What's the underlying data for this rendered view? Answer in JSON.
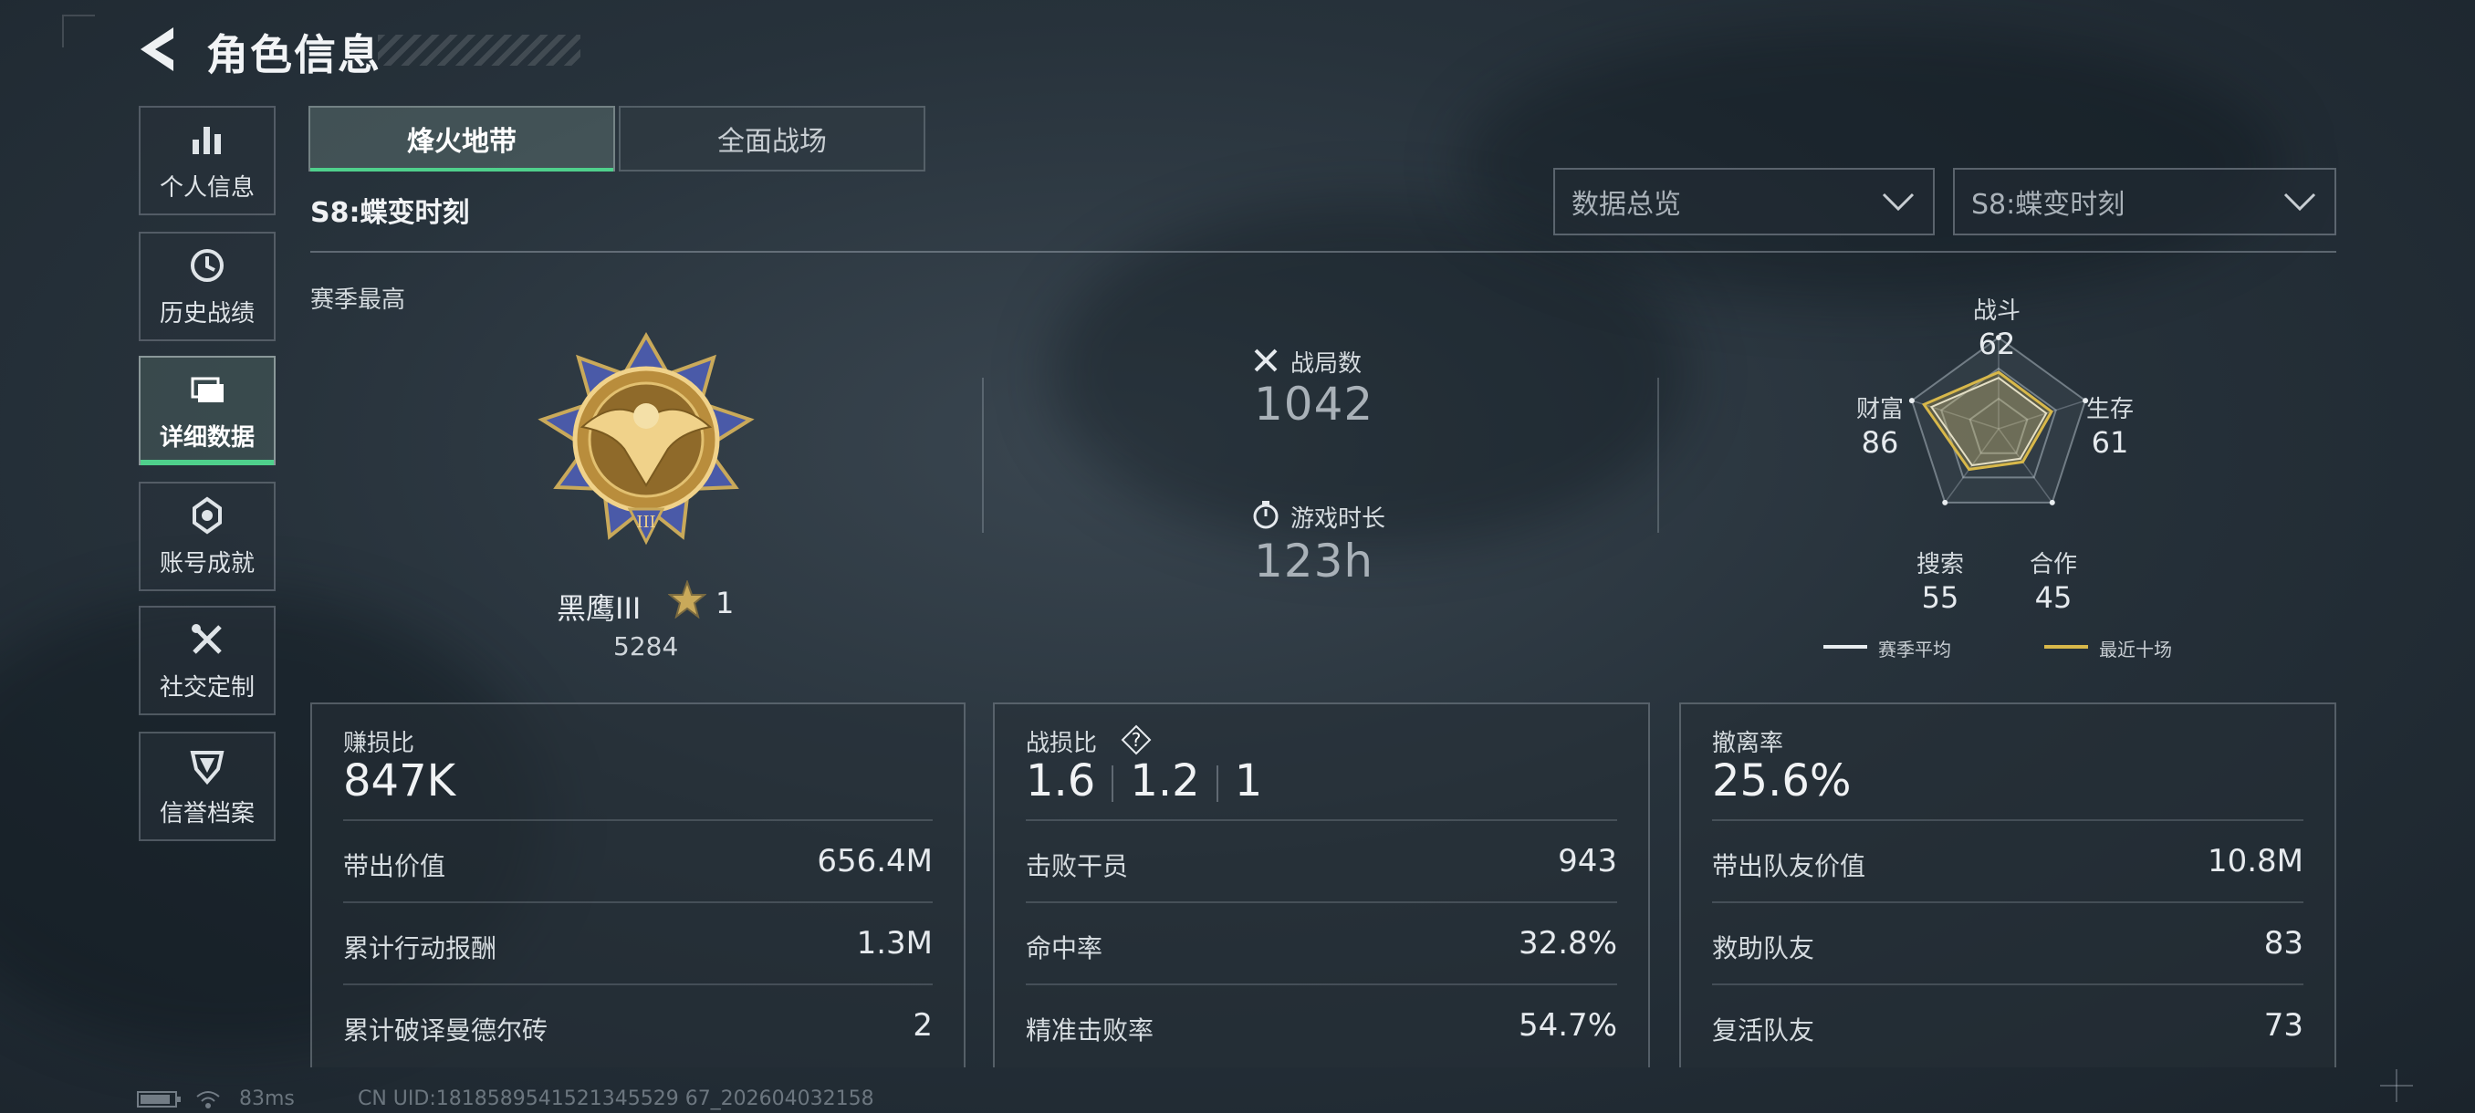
{
  "header": {
    "title": "角色信息"
  },
  "sidebar": {
    "items": [
      {
        "label": "个人信息",
        "icon": "bar-chart-icon"
      },
      {
        "label": "历史战绩",
        "icon": "history-icon"
      },
      {
        "label": "详细数据",
        "icon": "folder-icon",
        "active": true
      },
      {
        "label": "账号成就",
        "icon": "achievement-icon"
      },
      {
        "label": "社交定制",
        "icon": "tools-icon"
      },
      {
        "label": "信誉档案",
        "icon": "shield-icon"
      }
    ]
  },
  "tabs": [
    {
      "label": "烽火地带",
      "active": true
    },
    {
      "label": "全面战场",
      "active": false
    }
  ],
  "season_title": "S8:蝶变时刻",
  "dropdowns": {
    "overview": "数据总览",
    "season": "S8:蝶变时刻"
  },
  "season_best": {
    "label": "赛季最高",
    "rank_name": "黑鹰III",
    "stars": "1",
    "score": "5284"
  },
  "stats": {
    "matches_label": "战局数",
    "matches_value": "1042",
    "playtime_label": "游戏时长",
    "playtime_value": "123h"
  },
  "radar": {
    "axes": [
      {
        "label": "战斗",
        "value": "62"
      },
      {
        "label": "生存",
        "value": "61"
      },
      {
        "label": "合作",
        "value": "45"
      },
      {
        "label": "搜索",
        "value": "55"
      },
      {
        "label": "财富",
        "value": "86"
      }
    ],
    "legend": {
      "season_avg": "赛季平均",
      "recent_ten": "最近十场"
    },
    "colors": {
      "season_avg": "#e8ecef",
      "recent_ten": "#d8b84a"
    }
  },
  "cards": {
    "profit": {
      "title": "赚损比",
      "main": "847K",
      "rows": [
        {
          "label": "带出价值",
          "value": "656.4M"
        },
        {
          "label": "累计行动报酬",
          "value": "1.3M"
        },
        {
          "label": "累计破译曼德尔砖",
          "value": "2"
        }
      ]
    },
    "combat": {
      "title": "战损比",
      "help": "?",
      "ratios": [
        "1.6",
        "1.2",
        "1"
      ],
      "rows": [
        {
          "label": "击败干员",
          "value": "943"
        },
        {
          "label": "命中率",
          "value": "32.8%"
        },
        {
          "label": "精准击败率",
          "value": "54.7%"
        }
      ]
    },
    "extract": {
      "title": "撤离率",
      "main": "25.6%",
      "rows": [
        {
          "label": "带出队友价值",
          "value": "10.8M"
        },
        {
          "label": "救助队友",
          "value": "83"
        },
        {
          "label": "复活队友",
          "value": "73"
        }
      ]
    }
  },
  "footer": {
    "ping": "83ms",
    "uid": "CN UID:1818589541521345529 67_202604032158"
  },
  "accent": "#4fd08c"
}
